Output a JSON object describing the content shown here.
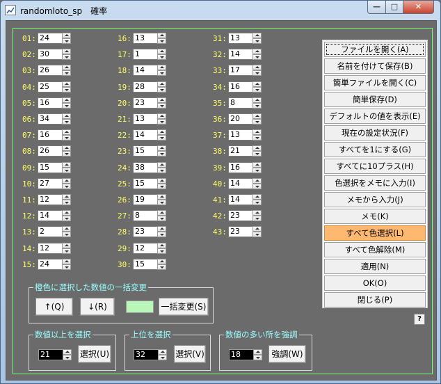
{
  "window": {
    "title": "randomloto_sp　確率",
    "min_glyph": "—",
    "max_glyph": "□",
    "close_glyph": "✕"
  },
  "numbers": [
    {
      "label": "01:",
      "value": "24"
    },
    {
      "label": "02:",
      "value": "30"
    },
    {
      "label": "03:",
      "value": "26"
    },
    {
      "label": "04:",
      "value": "25"
    },
    {
      "label": "05:",
      "value": "16"
    },
    {
      "label": "06:",
      "value": "34"
    },
    {
      "label": "07:",
      "value": "16"
    },
    {
      "label": "08:",
      "value": "26"
    },
    {
      "label": "09:",
      "value": "15"
    },
    {
      "label": "10:",
      "value": "27"
    },
    {
      "label": "11:",
      "value": "12"
    },
    {
      "label": "12:",
      "value": "14"
    },
    {
      "label": "13:",
      "value": "2"
    },
    {
      "label": "14:",
      "value": "12"
    },
    {
      "label": "15:",
      "value": "24"
    },
    {
      "label": "16:",
      "value": "13"
    },
    {
      "label": "17:",
      "value": "1"
    },
    {
      "label": "18:",
      "value": "14"
    },
    {
      "label": "19:",
      "value": "28"
    },
    {
      "label": "20:",
      "value": "23"
    },
    {
      "label": "21:",
      "value": "13"
    },
    {
      "label": "22:",
      "value": "14"
    },
    {
      "label": "23:",
      "value": "15"
    },
    {
      "label": "24:",
      "value": "38"
    },
    {
      "label": "25:",
      "value": "15"
    },
    {
      "label": "26:",
      "value": "19"
    },
    {
      "label": "27:",
      "value": "8"
    },
    {
      "label": "28:",
      "value": "23"
    },
    {
      "label": "29:",
      "value": "12"
    },
    {
      "label": "30:",
      "value": "15"
    },
    {
      "label": "31:",
      "value": "13"
    },
    {
      "label": "32:",
      "value": "14"
    },
    {
      "label": "33:",
      "value": "17"
    },
    {
      "label": "34:",
      "value": "16"
    },
    {
      "label": "35:",
      "value": "8"
    },
    {
      "label": "36:",
      "value": "20"
    },
    {
      "label": "37:",
      "value": "13"
    },
    {
      "label": "38:",
      "value": "21"
    },
    {
      "label": "39:",
      "value": "16"
    },
    {
      "label": "40:",
      "value": "14"
    },
    {
      "label": "41:",
      "value": "14"
    },
    {
      "label": "42:",
      "value": "23"
    },
    {
      "label": "43:",
      "value": "23"
    }
  ],
  "menu": [
    "ファイルを開く(A)",
    "名前を付けて保存(B)",
    "簡単ファイルを開く(C)",
    "簡単保存(D)",
    "デフォルトの値を表示(E)",
    "現在の設定状況(F)",
    "すべてを1にする(G)",
    "すべてに10プラス(H)",
    "色選択をメモに入力(I)",
    "メモから入力(J)",
    "メモ(K)",
    "すべて色選択(L)",
    "すべて色解除(M)",
    "適用(N)",
    "OK(O)",
    "閉じる(P)"
  ],
  "menu_selected_index": 11,
  "help_label": "?",
  "bulk_change": {
    "title": "橙色に選択した数値の一括変更",
    "up_label": "↑(Q)",
    "down_label": "↓(R)",
    "apply_label": "一括変更(S)",
    "swatch_color": "#b8f7b8"
  },
  "above_select": {
    "title": "数値以上を選択",
    "value": "21",
    "button_label": "選択(U)"
  },
  "top_select": {
    "title": "上位を選択",
    "value": "32",
    "button_label": "選択(V)"
  },
  "emphasize": {
    "title": "数値の多い所を強調",
    "value": "18",
    "button_label": "強調(W)"
  }
}
